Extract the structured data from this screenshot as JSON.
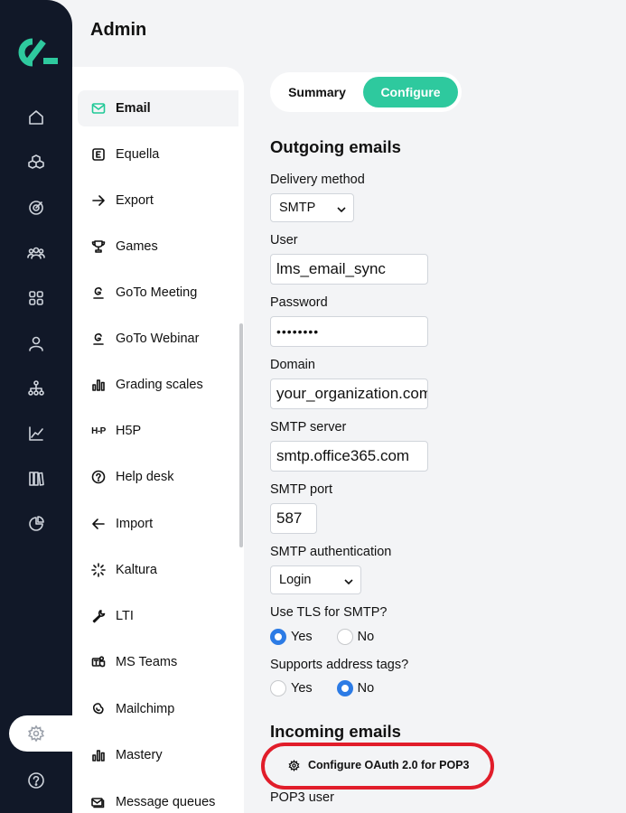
{
  "page": {
    "title": "Admin"
  },
  "rail": {
    "icons": [
      "logo",
      "home-icon",
      "cubes-icon",
      "target-icon",
      "users-icon",
      "grid-icon",
      "user-icon",
      "org-chart-icon",
      "trend-chart-icon",
      "library-icon",
      "pie-chart-icon",
      "settings-icon",
      "help-icon"
    ],
    "brand_color": "#2ec99e",
    "background": "#111828"
  },
  "nav": {
    "items": [
      {
        "label": "Email",
        "icon": "mail-icon",
        "active": true
      },
      {
        "label": "Equella",
        "icon": "equella-icon"
      },
      {
        "label": "Export",
        "icon": "arrow-right-icon"
      },
      {
        "label": "Games",
        "icon": "trophy-icon"
      },
      {
        "label": "GoTo Meeting",
        "icon": "goto-icon"
      },
      {
        "label": "GoTo Webinar",
        "icon": "goto-icon"
      },
      {
        "label": "Grading scales",
        "icon": "bars-icon"
      },
      {
        "label": "H5P",
        "icon": "h5p-icon"
      },
      {
        "label": "Help desk",
        "icon": "question-icon"
      },
      {
        "label": "Import",
        "icon": "arrow-left-icon"
      },
      {
        "label": "Kaltura",
        "icon": "kaltura-icon"
      },
      {
        "label": "LTI",
        "icon": "wrench-icon"
      },
      {
        "label": "MS Teams",
        "icon": "teams-icon"
      },
      {
        "label": "Mailchimp",
        "icon": "mailchimp-icon"
      },
      {
        "label": "Mastery",
        "icon": "bars-icon"
      },
      {
        "label": "Message queues",
        "icon": "queue-icon"
      }
    ],
    "h5p_logo_text": "H-P"
  },
  "tabs": {
    "summary": "Summary",
    "configure": "Configure",
    "active": "Configure"
  },
  "outgoing": {
    "heading": "Outgoing emails",
    "delivery_method_label": "Delivery method",
    "delivery_method_value": "SMTP",
    "user_label": "User",
    "user_value": "lms_email_sync",
    "password_label": "Password",
    "password_value": "••••••••",
    "domain_label": "Domain",
    "domain_value": "your_organization.com",
    "smtp_server_label": "SMTP server",
    "smtp_server_value": "smtp.office365.com",
    "smtp_port_label": "SMTP port",
    "smtp_port_value": "587",
    "smtp_auth_label": "SMTP authentication",
    "smtp_auth_value": "Login",
    "tls_label": "Use TLS for SMTP?",
    "tls_yes": "Yes",
    "tls_no": "No",
    "tls_selected": "Yes",
    "address_tags_label": "Supports address tags?",
    "address_tags_yes": "Yes",
    "address_tags_no": "No",
    "address_tags_selected": "No"
  },
  "incoming": {
    "heading": "Incoming emails",
    "oauth_button": "Configure OAuth 2.0 for POP3",
    "pop3_user_label": "POP3 user"
  },
  "colors": {
    "accent": "#2ec99e",
    "radio_selected": "#2c7be5",
    "highlight": "#e11d2a"
  }
}
